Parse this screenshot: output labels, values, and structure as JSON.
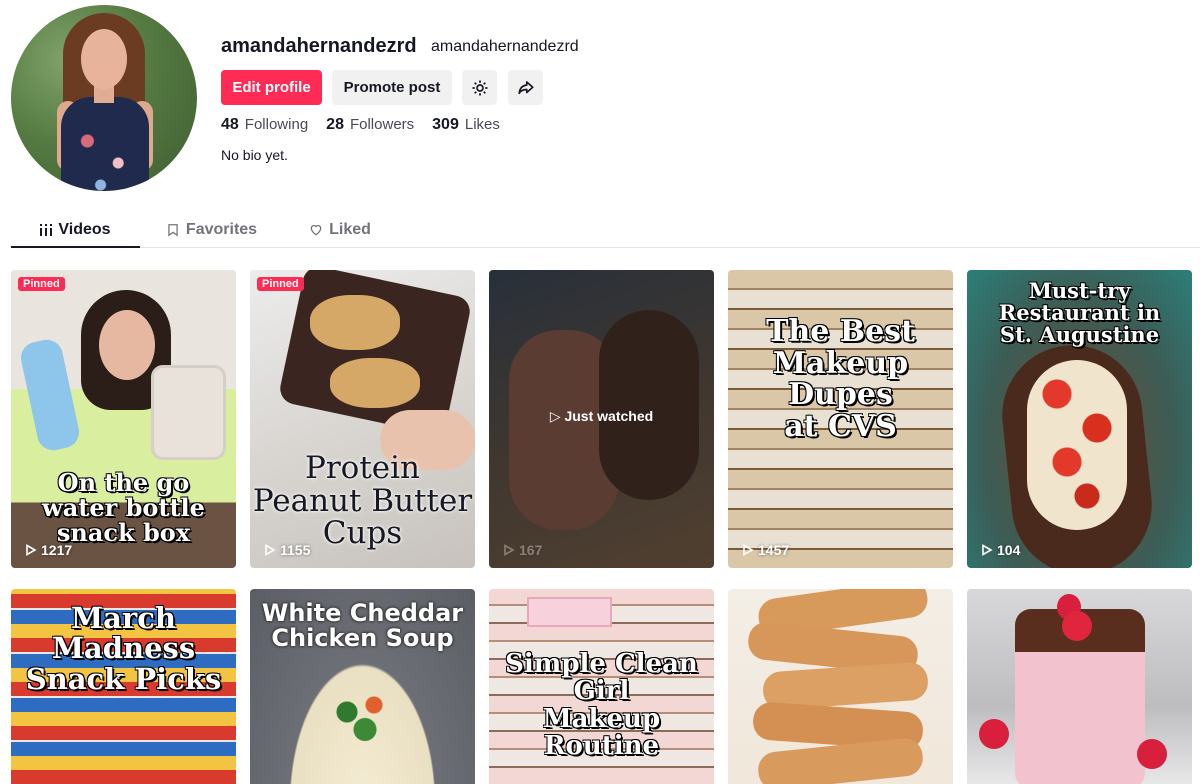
{
  "profile": {
    "username": "amandahernandezrd",
    "nickname": "amandahernandezrd",
    "bio": "No bio yet.",
    "stats": [
      {
        "value": "48",
        "label": "Following"
      },
      {
        "value": "28",
        "label": "Followers"
      },
      {
        "value": "309",
        "label": "Likes"
      }
    ]
  },
  "actions": {
    "edit_label": "Edit profile",
    "promote_label": "Promote post",
    "settings_icon": "gear-icon",
    "share_icon": "share-icon"
  },
  "tabs": [
    {
      "label": "Videos",
      "icon": "grid-icon",
      "active": true
    },
    {
      "label": "Favorites",
      "icon": "bookmark-icon",
      "active": false
    },
    {
      "label": "Liked",
      "icon": "heart-icon",
      "active": false
    }
  ],
  "colors": {
    "accent": "#fe2c55",
    "text": "#161823",
    "muted": "#73747b"
  },
  "videos": [
    {
      "pinned_label": "Pinned",
      "title": "On the go\nwater bottle\nsnack box",
      "views": "1217"
    },
    {
      "pinned_label": "Pinned",
      "title": "Protein\nPeanut Butter\nCups",
      "views": "1155"
    },
    {
      "status": "Just watched",
      "views": "167"
    },
    {
      "title": "The Best\nMakeup Dupes\nat CVS",
      "views": "1457"
    },
    {
      "title": "Must-try\nRestaurant in\nSt. Augustine",
      "views": "104"
    },
    {
      "title": "March Madness\nSnack Picks"
    },
    {
      "title": "White Cheddar\nChicken Soup"
    },
    {
      "title": "Simple Clean Girl\nMakeup Routine"
    },
    {},
    {}
  ]
}
